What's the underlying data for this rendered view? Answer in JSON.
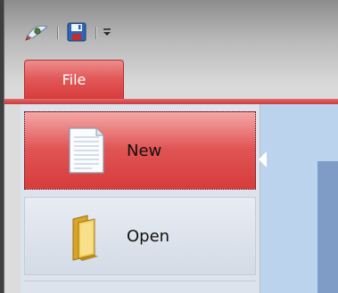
{
  "ribbon": {
    "file_tab_label": "File"
  },
  "quick_access": {
    "items": [
      {
        "name": "pen-icon"
      },
      {
        "name": "save-icon"
      },
      {
        "name": "customize-dropdown-icon"
      }
    ]
  },
  "file_menu": {
    "items": [
      {
        "label": "New",
        "icon": "new-document-icon",
        "state": "selected"
      },
      {
        "label": "Open",
        "icon": "folder-icon",
        "state": "normal"
      }
    ]
  },
  "colors": {
    "accent": "#e05050",
    "menu_background": "#dde3ec",
    "document_area": "#bcd3ee"
  }
}
